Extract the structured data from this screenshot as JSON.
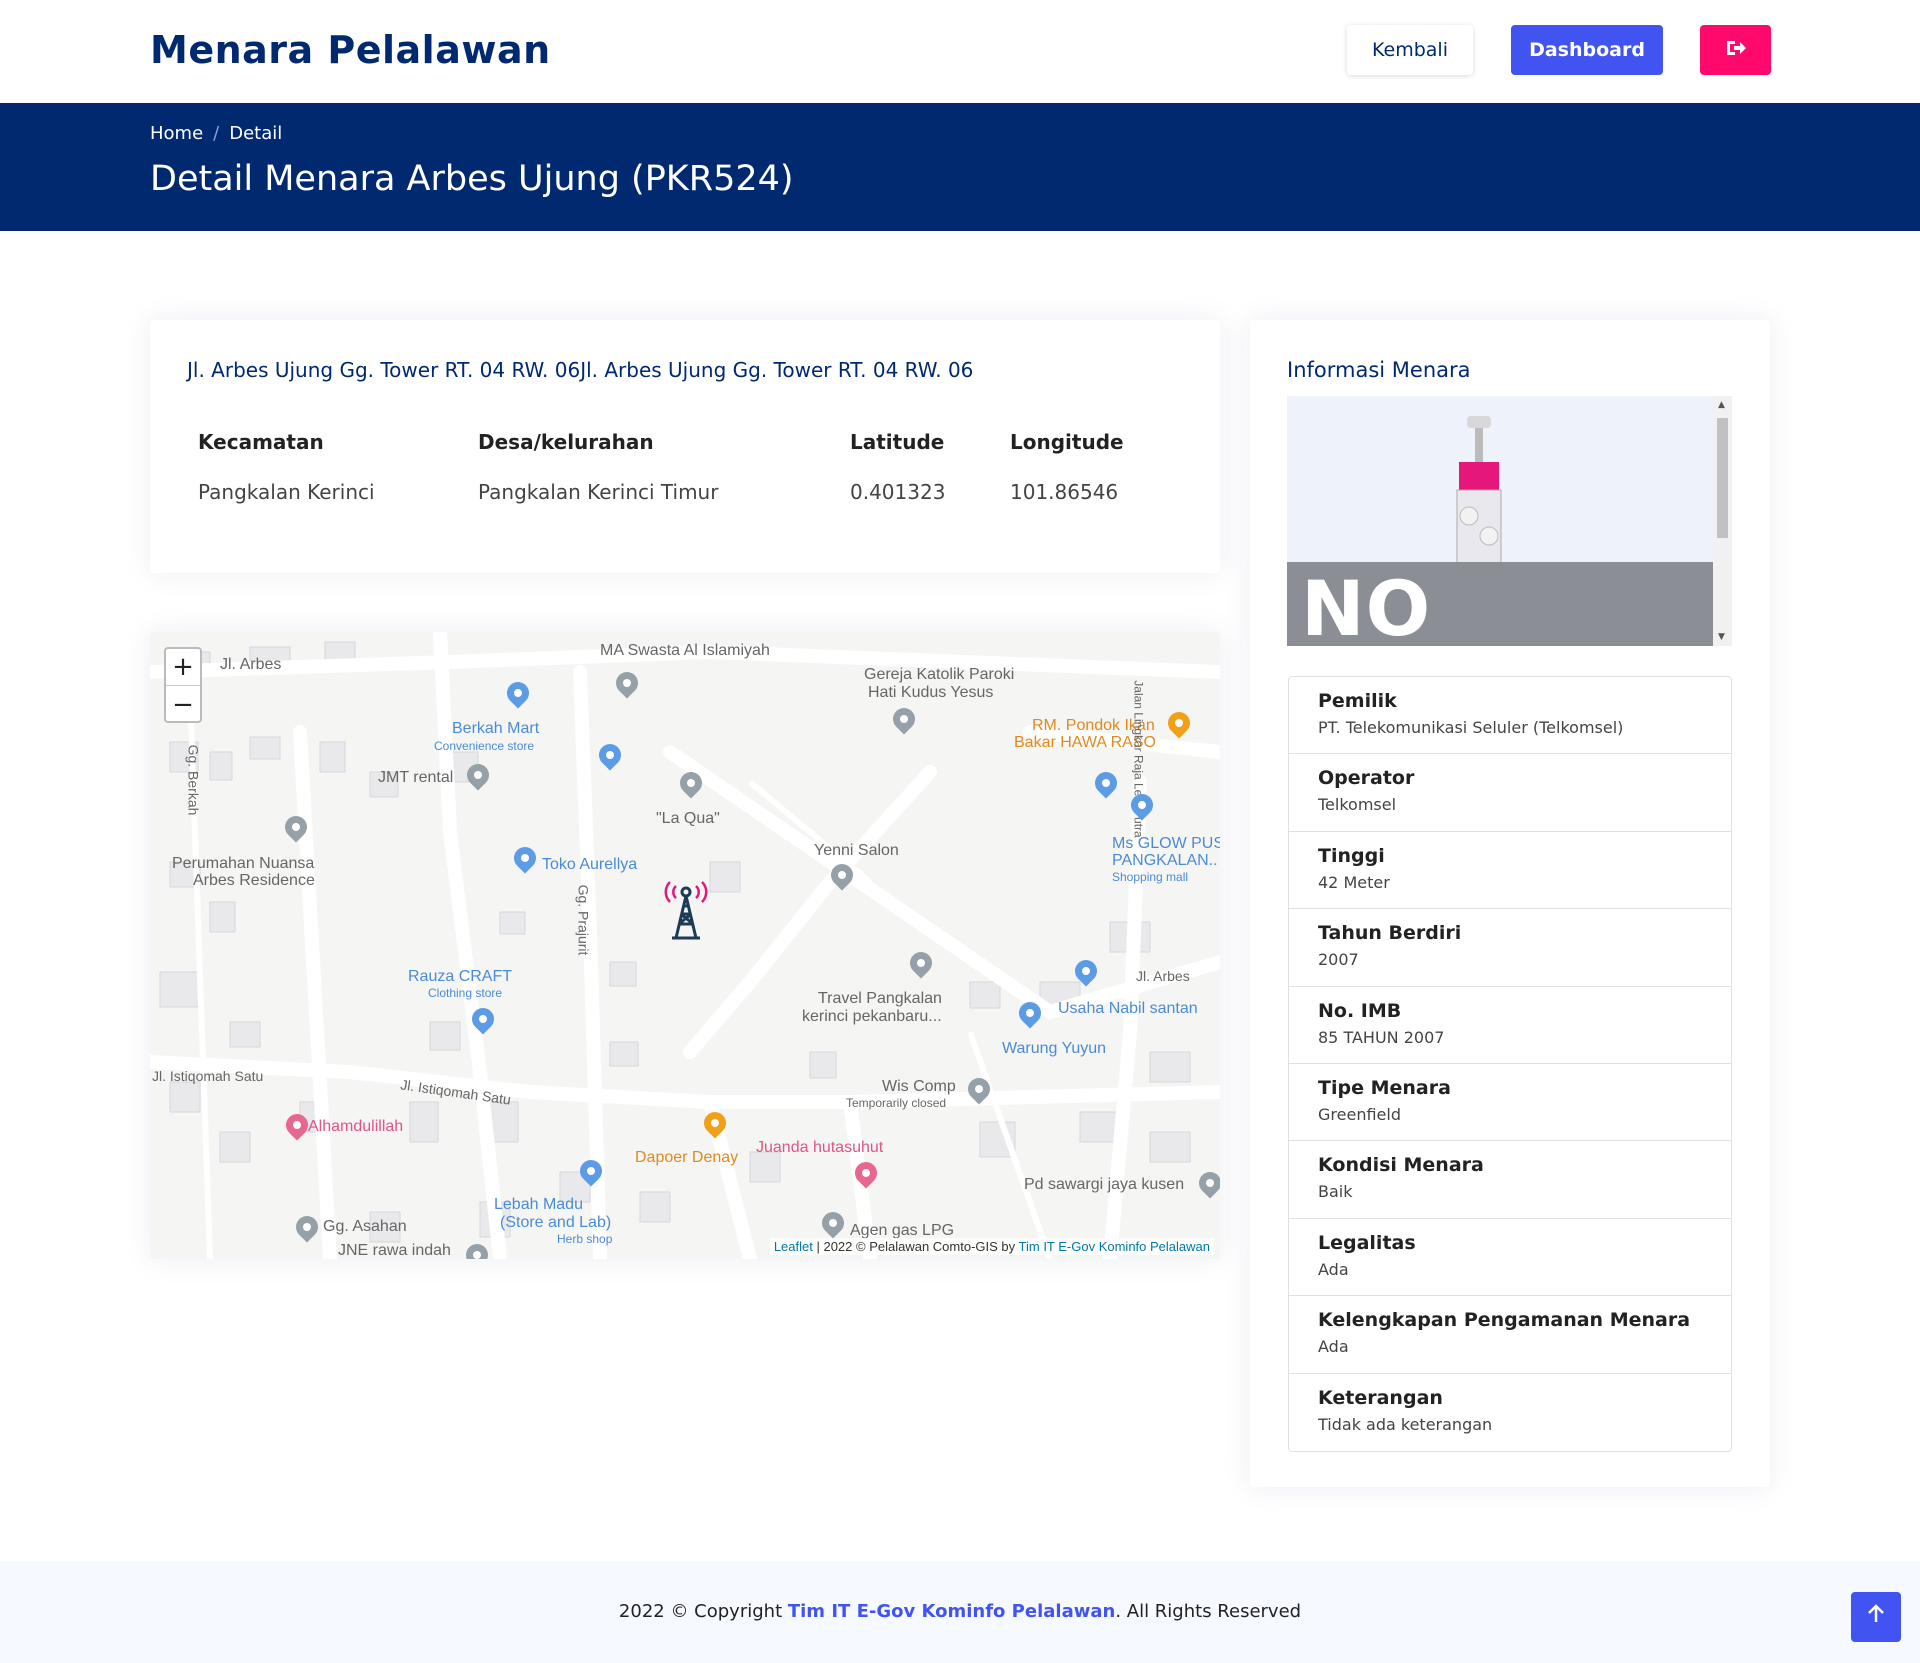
{
  "header": {
    "brand": "Menara Pelalawan",
    "back_label": "Kembali",
    "dashboard_label": "Dashboard"
  },
  "hero": {
    "breadcrumb_home": "Home",
    "breadcrumb_current": "Detail",
    "title": "Detail Menara Arbes Ujung (PKR524)"
  },
  "location": {
    "address": "Jl. Arbes Ujung Gg. Tower RT. 04 RW. 06Jl. Arbes Ujung Gg. Tower RT. 04 RW. 06",
    "headers": [
      "Kecamatan",
      "Desa/kelurahan",
      "Latitude",
      "Longitude"
    ],
    "values": [
      "Pangkalan Kerinci",
      "Pangkalan Kerinci Timur",
      "0.401323",
      "101.86546"
    ]
  },
  "map": {
    "zoom_in": "+",
    "zoom_out": "−",
    "attribution_leaflet": "Leaflet",
    "attribution_text": " | 2022 © Pelalawan Comto-GIS by ",
    "attribution_author": "Tim IT E-Gov Kominfo Pelalawan",
    "labels": [
      "MA Swasta Al Islamiyah",
      "Jl. Arbes",
      "Gereja Katolik Paroki",
      "Hati Kudus Yesus",
      "Berkah Mart",
      "Convenience store",
      "RM. Pondok Ikan",
      "Bakar HAWA RASO",
      "JMT rental",
      "Gg. Berkah",
      "\"La Qua\"",
      "Ms GLOW PUS",
      "PANGKALAN..",
      "Shopping mall",
      "Yenni Salon",
      "Perumahan Nuansa",
      "Arbes Residence",
      "Toko Aurellya",
      "Gg. Prajurit",
      "Rauza CRAFT",
      "Clothing store",
      "Jl. Arbes",
      "Travel Pangkalan",
      "kerinci pekanbaru...",
      "Usaha Nabil santan",
      "Warung Yuyun",
      "Jl. Istiqomah Satu",
      "Jl. Istiqomah Satu",
      "Wis Comp",
      "Temporarily closed",
      "Alhamdulillah",
      "Dapoer Denay",
      "Juanda hutasuhut",
      "Pd sawargi jaya kusen",
      "Lebah Madu",
      "(Store and Lab)",
      "Herb shop",
      "Gg. Asahan",
      "JNE rawa indah",
      "Agen gas LPG",
      "Jalan Lingkar Raja Lela Putra"
    ]
  },
  "info": {
    "title": "Informasi Menara",
    "photo_text": "NO PHOTO",
    "items": [
      {
        "k": "Pemilik",
        "v": "PT. Telekomunikasi Seluler (Telkomsel)"
      },
      {
        "k": "Operator",
        "v": "Telkomsel"
      },
      {
        "k": "Tinggi",
        "v": "42 Meter"
      },
      {
        "k": "Tahun Berdiri",
        "v": "2007"
      },
      {
        "k": "No. IMB",
        "v": "85 TAHUN 2007"
      },
      {
        "k": "Tipe Menara",
        "v": "Greenfield"
      },
      {
        "k": "Kondisi Menara",
        "v": "Baik"
      },
      {
        "k": "Legalitas",
        "v": "Ada"
      },
      {
        "k": "Kelengkapan Pengamanan Menara",
        "v": "Ada"
      },
      {
        "k": "Keterangan",
        "v": "Tidak ada keterangan"
      }
    ]
  },
  "footer": {
    "prefix": "2022 © Copyright ",
    "owner": "Tim IT E-Gov Kominfo Pelalawan",
    "suffix": ". All Rights Reserved"
  },
  "colors": {
    "navy": "#012970",
    "primary": "#4154f1",
    "danger": "#ff0a6c"
  },
  "icons": {
    "logout": "sign-out-icon",
    "back_to_top": "arrow-up-icon",
    "tower_marker": "tower-icon"
  }
}
